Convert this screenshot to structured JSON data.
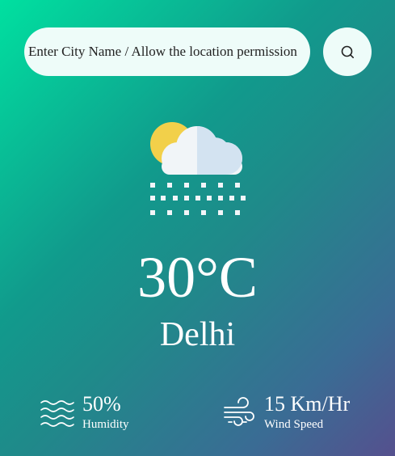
{
  "search": {
    "placeholder": "Enter City Name / Allow the location permission",
    "button_icon": "search-icon"
  },
  "weather": {
    "icon": "cloud-sun-snow-icon",
    "temperature": "30°C",
    "city": "Delhi"
  },
  "details": {
    "humidity": {
      "icon": "waves-icon",
      "value": "50%",
      "label": "Humidity"
    },
    "wind": {
      "icon": "wind-icon",
      "value": "15 Km/Hr",
      "label": "Wind Speed"
    }
  },
  "colors": {
    "gradient_start": "#00e0a0",
    "gradient_end": "#55508e",
    "input_bg": "#eefcf9",
    "sun": "#f2d04a",
    "cloud": "#f1f5f8",
    "cloud_shade": "#d3e3f1"
  }
}
